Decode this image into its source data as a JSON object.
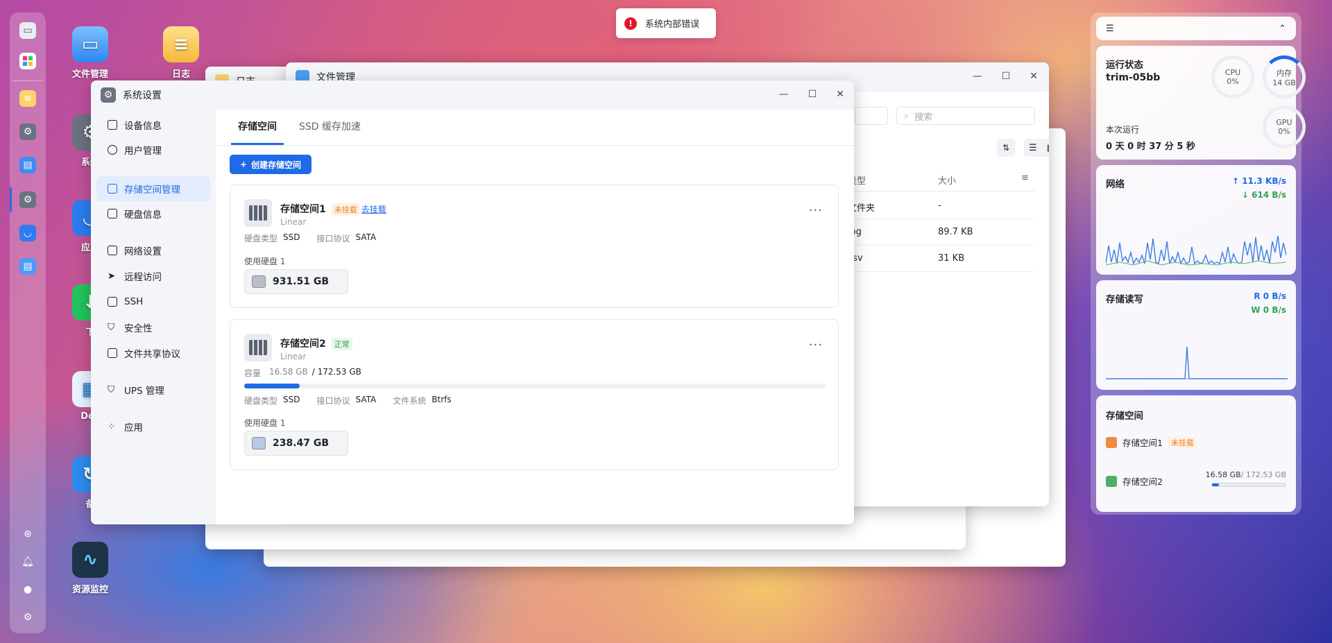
{
  "toast": {
    "text": "系统内部错误"
  },
  "desktop": {
    "icons": [
      {
        "label": "文件管理"
      },
      {
        "label": "日志"
      },
      {
        "label": "系统"
      },
      {
        "label": "应用"
      },
      {
        "label": "下"
      },
      {
        "label": "Doc"
      },
      {
        "label": "备"
      },
      {
        "label": "资源监控"
      }
    ]
  },
  "bg_windows": {
    "log_title": "日志",
    "file_title": "文件管理",
    "search_placeholder": "搜索",
    "col_type": "类型",
    "col_size": "大小",
    "rows": [
      {
        "type": "文件夹",
        "size": "-"
      },
      {
        "type": "log",
        "size": "89.7 KB"
      },
      {
        "type": "csv",
        "size": "31 KB"
      }
    ]
  },
  "settings": {
    "title": "系统设置",
    "sidebar": [
      {
        "label": "设备信息"
      },
      {
        "label": "用户管理"
      },
      {
        "label": "存储空间管理"
      },
      {
        "label": "硬盘信息"
      },
      {
        "label": "网络设置"
      },
      {
        "label": "远程访问"
      },
      {
        "label": "SSH"
      },
      {
        "label": "安全性"
      },
      {
        "label": "文件共享协议"
      },
      {
        "label": "UPS 管理"
      },
      {
        "label": "应用"
      }
    ],
    "tabs": [
      "存储空间",
      "SSD 缓存加速"
    ],
    "create_button": "创建存储空间",
    "pools": [
      {
        "name": "存储空间1",
        "status": "未挂载",
        "action": "去挂载",
        "raid": "Linear",
        "disk_type_label": "硬盘类型",
        "disk_type": "SSD",
        "protocol_label": "接口协议",
        "protocol": "SATA",
        "disks_label": "使用硬盘 1",
        "disk_size": "931.51 GB"
      },
      {
        "name": "存储空间2",
        "status": "正常",
        "raid": "Linear",
        "capacity_label": "容量",
        "used": "16.58 GB",
        "total": "/ 172.53 GB",
        "usage_fraction": 0.096,
        "disk_type_label": "硬盘类型",
        "disk_type": "SSD",
        "protocol_label": "接口协议",
        "protocol": "SATA",
        "fs_label": "文件系统",
        "fs": "Btrfs",
        "disks_label": "使用硬盘 1",
        "disk_size": "238.47 GB"
      }
    ]
  },
  "widgets": {
    "status": {
      "title": "运行状态",
      "host": "trim-05bb",
      "cpu_label": "CPU",
      "cpu_value": "0%",
      "mem_label": "内存",
      "mem_value": "14 GB",
      "gpu_label": "GPU",
      "gpu_value": "0%",
      "uptime_label": "本次运行",
      "uptime": "0 天 0 时 37 分 5 秒"
    },
    "network": {
      "title": "网络",
      "up": "11.3 KB/s",
      "down": "614 B/s"
    },
    "disk_io": {
      "title": "存储读写",
      "read": "R  0 B/s",
      "write": "W  0 B/s"
    },
    "storage": {
      "title": "存储空间",
      "pool1_name": "存储空间1",
      "pool1_status": "未挂载",
      "pool2_name": "存储空间2",
      "pool2_used": "16.58 GB",
      "pool2_total": "/ 172.53 GB",
      "pool2_fraction": 0.096
    }
  },
  "colors": {
    "accent": "#1f6ae6",
    "warning": "#f07a1a",
    "ok": "#2ea44f",
    "error": "#e0182a"
  }
}
